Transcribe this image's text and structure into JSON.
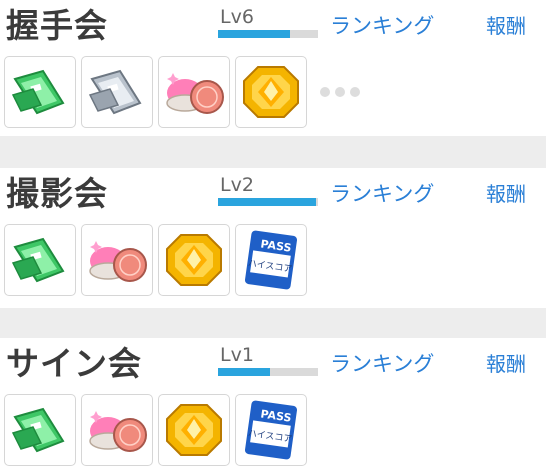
{
  "events": [
    {
      "title": "握手会",
      "level_label": "Lv6",
      "level_progress": 0.72,
      "ranking_label": "ランキング",
      "reward_label": "報酬",
      "items": [
        "green-ticket",
        "silver-ticket",
        "pink-cosmetic",
        "gold-gem"
      ],
      "has_more": true
    },
    {
      "title": "撮影会",
      "level_label": "Lv2",
      "level_progress": 0.98,
      "ranking_label": "ランキング",
      "reward_label": "報酬",
      "items": [
        "green-ticket",
        "pink-cosmetic",
        "gold-gem",
        "highscore-pass"
      ],
      "pass_text_top": "PASS",
      "pass_text_bottom": "ハイスコア"
    },
    {
      "title": "サイン会",
      "level_label": "Lv1",
      "level_progress": 0.52,
      "ranking_label": "ランキング",
      "reward_label": "報酬",
      "items": [
        "green-ticket",
        "pink-cosmetic",
        "gold-gem",
        "highscore-pass"
      ],
      "pass_text_top": "PASS",
      "pass_text_bottom": "ハイスコア"
    }
  ],
  "colors": {
    "link": "#2a7fd6",
    "level_bar": "#2aa4de",
    "level_track": "#dadada",
    "title": "#3b3b3b"
  }
}
